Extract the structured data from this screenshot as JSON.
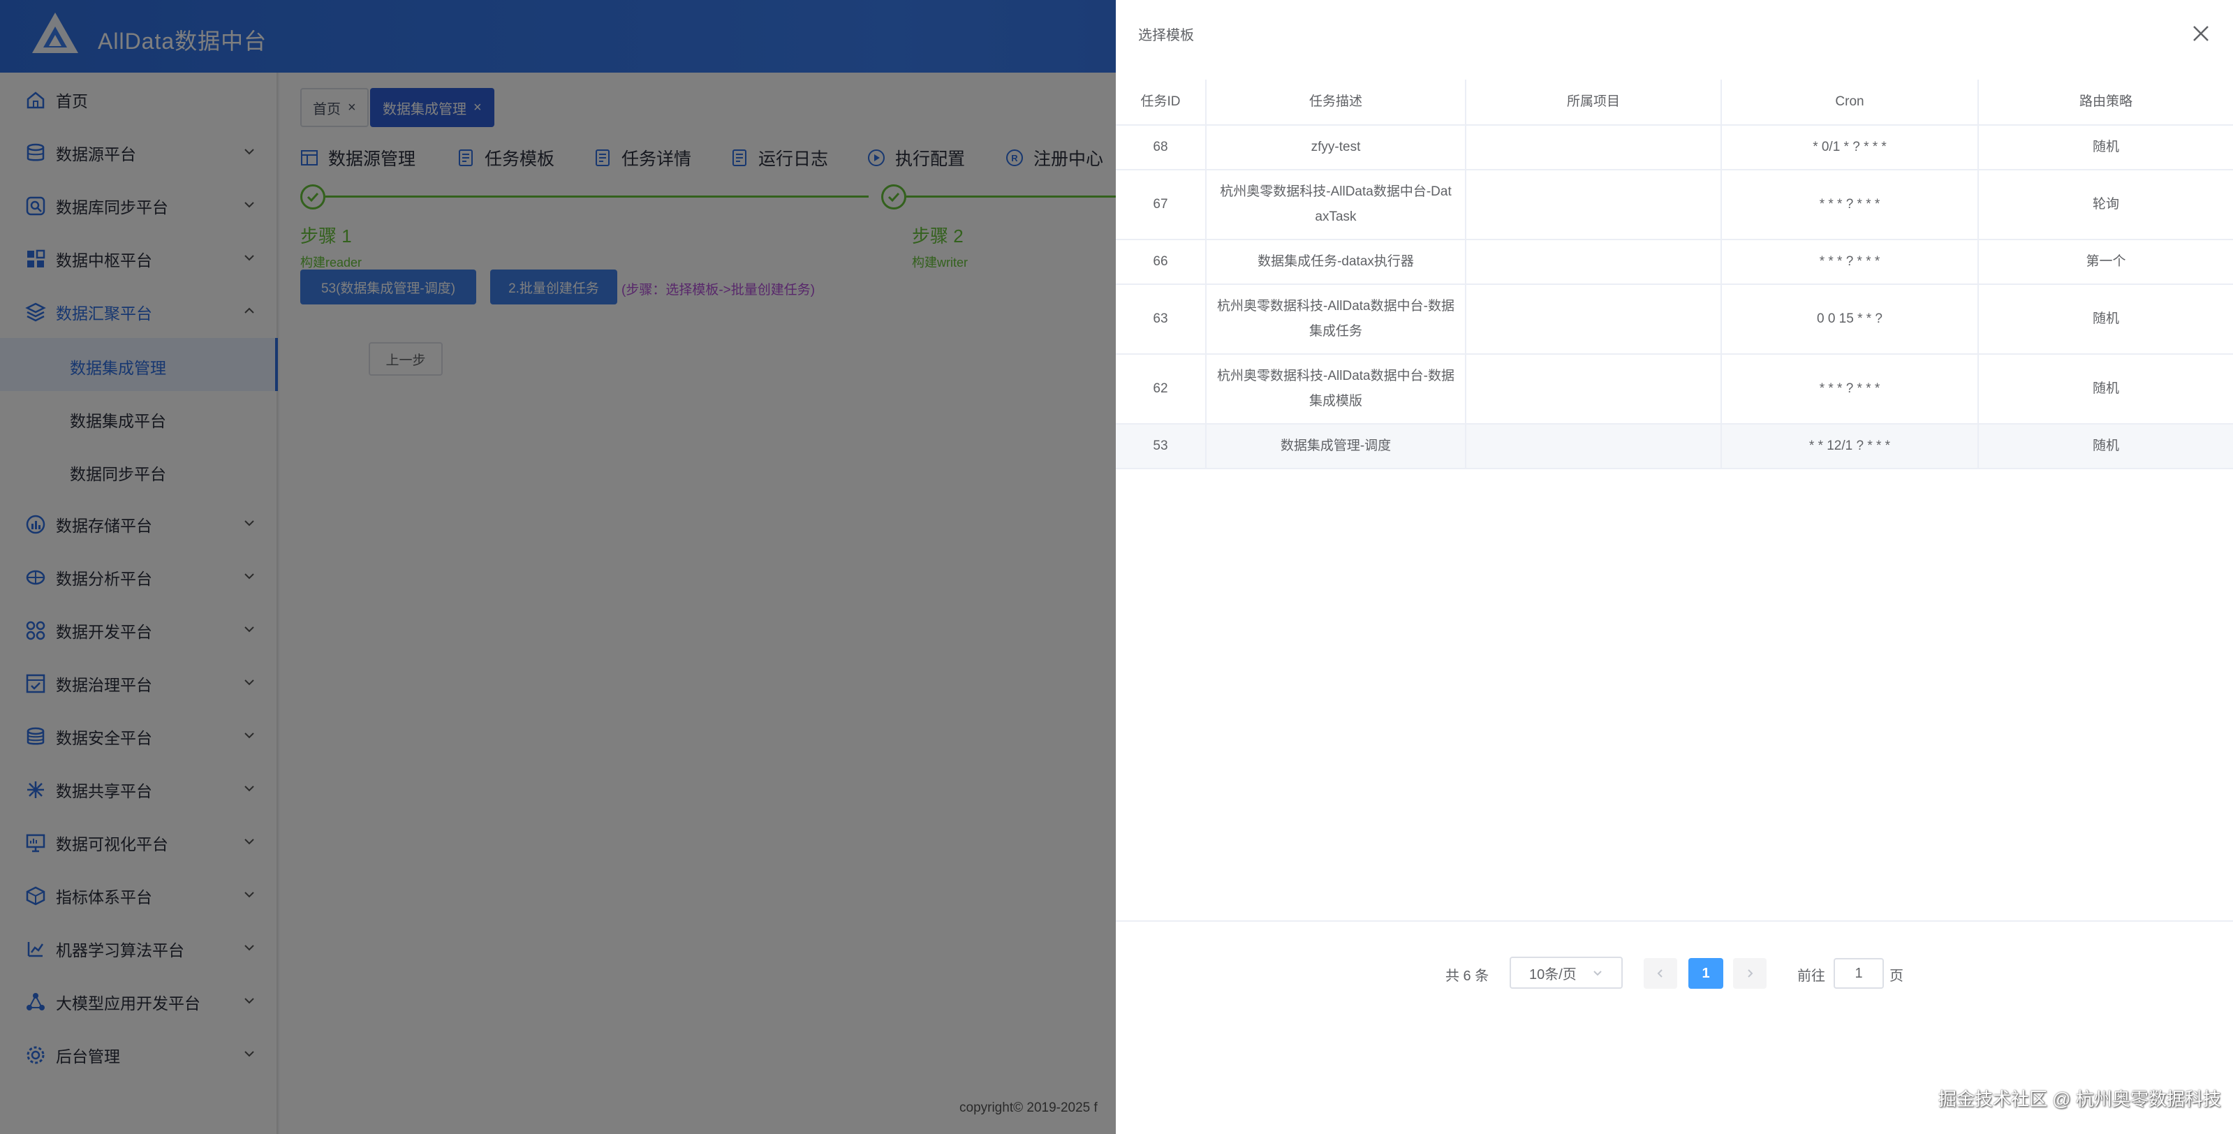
{
  "header": {
    "brand": "AllData数据中台"
  },
  "sidebar": {
    "items": [
      {
        "label": "首页",
        "icon": "home-icon"
      },
      {
        "label": "数据源平台",
        "icon": "database-icon"
      },
      {
        "label": "数据库同步平台",
        "icon": "sync-icon"
      },
      {
        "label": "数据中枢平台",
        "icon": "grid-icon"
      },
      {
        "label": "数据汇聚平台",
        "icon": "layers-icon"
      },
      {
        "label": "数据存储平台",
        "icon": "chart-icon"
      },
      {
        "label": "数据分析平台",
        "icon": "analysis-icon"
      },
      {
        "label": "数据开发平台",
        "icon": "code-icon"
      },
      {
        "label": "数据治理平台",
        "icon": "governance-icon"
      },
      {
        "label": "数据安全平台",
        "icon": "shield-icon"
      },
      {
        "label": "数据共享平台",
        "icon": "share-icon"
      },
      {
        "label": "数据可视化平台",
        "icon": "monitor-icon"
      },
      {
        "label": "指标体系平台",
        "icon": "cube-icon"
      },
      {
        "label": "机器学习算法平台",
        "icon": "ml-icon"
      },
      {
        "label": "大模型应用开发平台",
        "icon": "model-icon"
      },
      {
        "label": "后台管理",
        "icon": "gear-icon"
      }
    ],
    "subitems": [
      {
        "label": "数据集成管理"
      },
      {
        "label": "数据集成平台"
      },
      {
        "label": "数据同步平台"
      }
    ]
  },
  "tags": [
    {
      "label": "首页"
    },
    {
      "label": "数据集成管理"
    }
  ],
  "tabs": [
    {
      "label": "数据源管理"
    },
    {
      "label": "任务模板"
    },
    {
      "label": "任务详情"
    },
    {
      "label": "运行日志"
    },
    {
      "label": "执行配置"
    },
    {
      "label": "注册中心"
    }
  ],
  "steps": [
    {
      "title": "步骤 1",
      "sub": "构建reader"
    },
    {
      "title": "步骤 2",
      "sub": "构建writer"
    }
  ],
  "actions": {
    "template_btn": "53(数据集成管理-调度)",
    "batch_btn": "2.批量创建任务",
    "hint": "(步骤：选择模板->批量创建任务)",
    "prev_btn": "上一步"
  },
  "footer": {
    "copyright": "copyright© 2019-2025 f"
  },
  "drawer": {
    "title": "选择模板",
    "columns": [
      "任务ID",
      "任务描述",
      "所属项目",
      "Cron",
      "路由策略"
    ],
    "rows": [
      {
        "id": "68",
        "desc": "zfyy-test",
        "project": "",
        "cron": "* 0/1 * ? * * *",
        "route": "随机"
      },
      {
        "id": "67",
        "desc": "杭州奥零数据科技-AllData数据中台-DataxTask",
        "project": "",
        "cron": "* * * ? * * *",
        "route": "轮询"
      },
      {
        "id": "66",
        "desc": "数据集成任务-datax执行器",
        "project": "",
        "cron": "* * * ? * * *",
        "route": "第一个"
      },
      {
        "id": "63",
        "desc": "杭州奥零数据科技-AllData数据中台-数据集成任务",
        "project": "",
        "cron": "0 0 15 * * ?",
        "route": "随机"
      },
      {
        "id": "62",
        "desc": "杭州奥零数据科技-AllData数据中台-数据集成模版",
        "project": "",
        "cron": "* * * ? * * *",
        "route": "随机"
      },
      {
        "id": "53",
        "desc": "数据集成管理-调度",
        "project": "",
        "cron": "* * 12/1 ? * * *",
        "route": "随机"
      }
    ],
    "pagination": {
      "total": "共 6 条",
      "page_size": "10条/页",
      "current": "1",
      "goto_label": "前往",
      "goto_value": "1",
      "page_unit": "页"
    }
  },
  "watermark": "掘金技术社区 @ 杭州奥零数据科技"
}
